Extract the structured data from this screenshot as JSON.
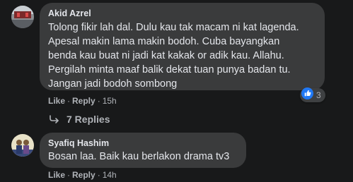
{
  "comments": [
    {
      "author": "Akid Azrel",
      "lines": [
        "Tolong fikir lah dal. Dulu kau tak macam ni kat lagenda.",
        "Apesal makin lama makin bodoh. Cuba bayangkan",
        "benda kau buat ni jadi kat kakak or adik kau. Allahu.",
        "Pergilah minta maaf balik dekat tuan punya badan tu.",
        "Jangan jadi bodoh sombong"
      ],
      "like_label": "Like",
      "reply_label": "Reply",
      "time": "15h",
      "reaction_count": "3",
      "replies_label": "7 Replies"
    },
    {
      "author": "Syafiq Hashim",
      "lines": [
        "Bosan laa. Baik kau berlakon drama tv3"
      ],
      "like_label": "Like",
      "reply_label": "Reply",
      "time": "14h"
    }
  ],
  "colors": {
    "background": "#18191a",
    "bubble": "#3a3b3c",
    "text": "#e4e6eb",
    "secondary_text": "#b0b3b8",
    "like_blue": "#2078f4"
  },
  "icons": {
    "reaction": "like-thumb-icon",
    "replies": "reply-arrow-icon"
  }
}
